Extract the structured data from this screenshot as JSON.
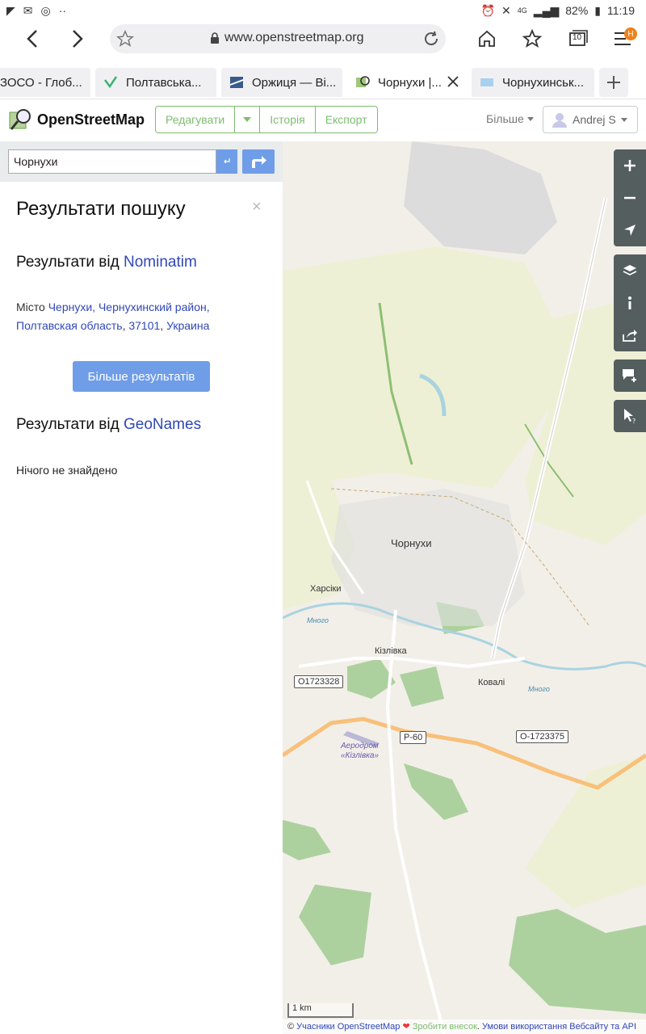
{
  "status_bar": {
    "battery": "82%",
    "time": "11:19",
    "network": "4G"
  },
  "browser": {
    "url": "www.openstreetmap.org",
    "tab_count": "10",
    "profile_initial": "H",
    "tabs": [
      {
        "title": "ЗОСО - Глоб..."
      },
      {
        "title": "Полтавська..."
      },
      {
        "title": "Оржиця — Ві..."
      },
      {
        "title": "Чорнухи |..."
      },
      {
        "title": "Чорнухинськ..."
      }
    ]
  },
  "osm": {
    "logo": "OpenStreetMap",
    "edit_label": "Редагувати",
    "history_label": "Історія",
    "export_label": "Експорт",
    "more_label": "Більше",
    "user_name": "Andrej S",
    "search_value": "Чорнухи"
  },
  "sidebar": {
    "title": "Результати пошуку",
    "close": "×",
    "nominatim_prefix": "Результати від",
    "nominatim_link": "Nominatim",
    "result_type": "Місто",
    "result_line1": "Чернухи, Чернухинский район,",
    "result_line2_a": "Полтавская область",
    "result_line2_b": "37101",
    "result_line2_c": "Украина",
    "more_results": "Більше результатів",
    "geonames_prefix": "Результати від",
    "geonames_link": "GeoNames",
    "nothing_found": "Нічого не знайдено"
  },
  "map": {
    "labels": {
      "town": "Чорнухи",
      "kharsiki": "Харсіки",
      "kizlivka": "Кізлівка",
      "kovali": "Ковалі",
      "aerodrome1": "Аеродром",
      "aerodrome2": "«Кізлівка»",
      "river1": "Многo",
      "river2": "Многo"
    },
    "shields": {
      "road1": "O1723328",
      "road2": "P-60",
      "road3": "O-1723375"
    },
    "scale_label": "1 km",
    "attribution_prefix": "© ",
    "attribution_link1": "Учасники OpenStreetMap",
    "attribution_link2": "Зробити внесок",
    "attribution_link3": "Умови використання Вебсайту та API"
  }
}
